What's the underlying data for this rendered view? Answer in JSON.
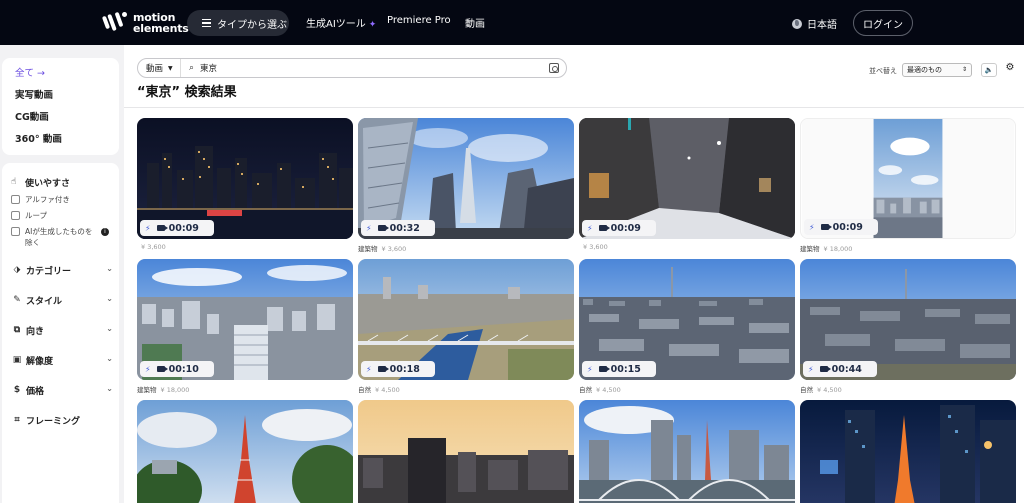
{
  "brand": {
    "name_line1": "motion",
    "name_line2": "elements"
  },
  "nav": {
    "type_button": "タイプから選ぶ",
    "ai_tools": "生成AIツール",
    "premiere": "Premiere Pro",
    "video": "動画",
    "language": "日本語",
    "login": "ログイン"
  },
  "sidebar": {
    "top_items": [
      {
        "label": "全て →",
        "active": true
      },
      {
        "label": "実写動画"
      },
      {
        "label": "CG動画"
      },
      {
        "label": "360° 動画"
      }
    ],
    "usability": {
      "title": "使いやすさ",
      "options": [
        "アルファ付き",
        "ループ",
        "AIが生成したものを除く"
      ]
    },
    "filters": [
      "カテゴリー",
      "スタイル",
      "向き",
      "解像度",
      "価格",
      "フレーミング"
    ]
  },
  "search": {
    "type": "動画",
    "query": "東京"
  },
  "results_title": "“東京” 検索結果",
  "sort": {
    "label": "並べ替え",
    "value": "最適のもの"
  },
  "cards": [
    {
      "duration": "00:09",
      "category": "",
      "price": "¥ 3,600",
      "scene": "night-skyline"
    },
    {
      "duration": "00:32",
      "category": "建築物",
      "price": "¥ 3,600",
      "scene": "skytree-fisheye"
    },
    {
      "duration": "00:09",
      "category": "",
      "price": "¥ 3,600",
      "scene": "snow-street"
    },
    {
      "duration": "00:09",
      "category": "建築物",
      "price": "¥ 18,000",
      "scene": "vertical-sky"
    },
    {
      "duration": "00:10",
      "category": "建築物",
      "price": "¥ 18,000",
      "scene": "aerial-city"
    },
    {
      "duration": "00:18",
      "category": "自然",
      "price": "¥ 4,500",
      "scene": "river-bridge"
    },
    {
      "duration": "00:15",
      "category": "自然",
      "price": "¥ 4,500",
      "scene": "panorama"
    },
    {
      "duration": "00:44",
      "category": "自然",
      "price": "¥ 4,500",
      "scene": "panorama2"
    },
    {
      "duration": "",
      "category": "",
      "price": "",
      "scene": "tokyo-tower-trees"
    },
    {
      "duration": "",
      "category": "",
      "price": "",
      "scene": "sunset-buildings"
    },
    {
      "duration": "",
      "category": "",
      "price": "",
      "scene": "rainbow-bridge"
    },
    {
      "duration": "",
      "category": "",
      "price": "",
      "scene": "night-tower"
    }
  ]
}
